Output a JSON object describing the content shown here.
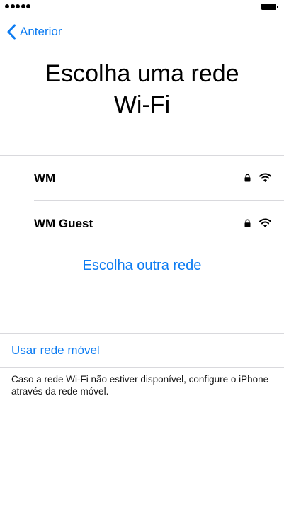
{
  "status_bar": {
    "signal_icon": "signal-dots-icon",
    "battery_icon": "battery-icon"
  },
  "nav": {
    "back_label": "Anterior",
    "back_icon": "chevron-left-icon"
  },
  "page": {
    "title": "Escolha uma rede Wi-Fi"
  },
  "networks": [
    {
      "name": "WM",
      "secured": true,
      "icons": [
        "lock-icon",
        "wifi-icon"
      ]
    },
    {
      "name": "WM Guest",
      "secured": true,
      "icons": [
        "lock-icon",
        "wifi-icon"
      ]
    }
  ],
  "other_network_label": "Escolha outra rede",
  "cellular": {
    "link_label": "Usar rede móvel",
    "note": "Caso a rede Wi-Fi não estiver disponível, configure o iPhone através da rede móvel."
  },
  "colors": {
    "accent": "#0d7cf2",
    "divider": "#d9d9dd"
  }
}
